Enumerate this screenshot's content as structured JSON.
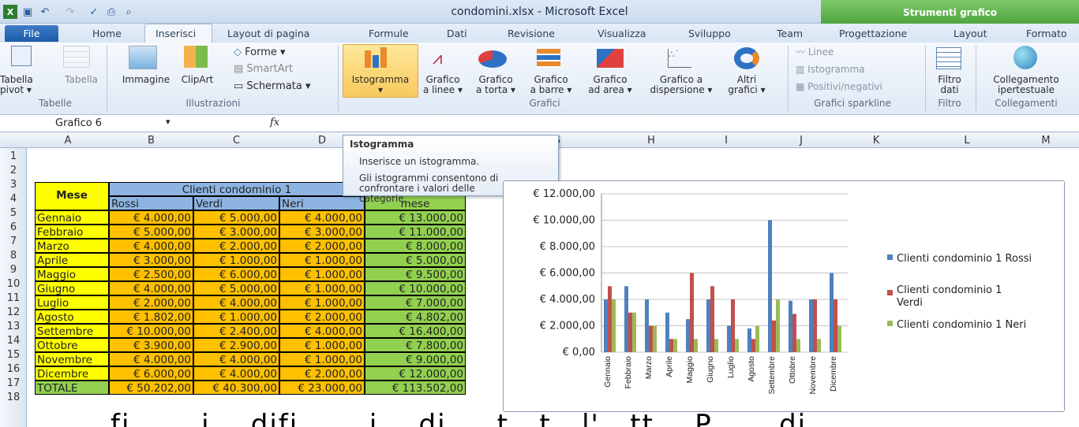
{
  "window": {
    "title": "condomini.xlsx - Microsoft Excel",
    "tools_label": "Strumenti grafico"
  },
  "tabs": [
    "File",
    "Home",
    "Inserisci",
    "Layout di pagina",
    "Formule",
    "Dati",
    "Revisione",
    "Visualizza",
    "Sviluppo",
    "Team",
    "Progettazione",
    "Layout",
    "Formato"
  ],
  "ribbon": {
    "tabelle": {
      "b1a": "Tabella",
      "b1b": "pivot ▾",
      "b2": "Tabella",
      "group": "Tabelle"
    },
    "illustrazioni": {
      "immagine": "Immagine",
      "clipart": "ClipArt",
      "forme": "Forme ▾",
      "smartart": "SmartArt",
      "schermata": "Schermata ▾",
      "group": "Illustrazioni"
    },
    "grafici": {
      "istogramma": "Istogramma",
      "linee_a": "Grafico",
      "linee_b": "a linee ▾",
      "torta_a": "Grafico",
      "torta_b": "a torta ▾",
      "barre_a": "Grafico",
      "barre_b": "a barre ▾",
      "area_a": "Grafico",
      "area_b": "ad area ▾",
      "disp_a": "Grafico a",
      "disp_b": "dispersione ▾",
      "altri_a": "Altri",
      "altri_b": "grafici ▾",
      "group": "Grafici"
    },
    "sparkline": {
      "linee": "Linee",
      "istogramma": "Istogramma",
      "positivi": "Positivi/negativi",
      "group": "Grafici sparkline"
    },
    "filtro": {
      "a": "Filtro",
      "b": "dati",
      "group": "Filtro"
    },
    "collegamenti": {
      "a": "Collegamento",
      "b": "ipertestuale",
      "group": "Collegamenti"
    }
  },
  "formula_bar": {
    "name": "Grafico 6",
    "fx": "fx"
  },
  "tooltip": {
    "title": "Istogramma",
    "line1": "Inserisce un istogramma.",
    "line2a": "Gli istogrammi consentono di",
    "line2b": "confrontare i valori delle",
    "line2c": "categorie."
  },
  "columns": [
    "A",
    "B",
    "C",
    "D",
    "E",
    "F",
    "G",
    "H",
    "I",
    "J",
    "K",
    "L",
    "M"
  ],
  "rows": [
    "1",
    "2",
    "3",
    "4",
    "5",
    "6",
    "7",
    "8",
    "9",
    "10",
    "11",
    "12",
    "13",
    "14",
    "15",
    "16",
    "17",
    "18"
  ],
  "sheet": {
    "mese": "Mese",
    "clienti": "Clienti condominio 1",
    "h_rossi": "Rossi",
    "h_verdi": "Verdi",
    "h_neri": "Neri",
    "h_mese": "mese",
    "data": [
      [
        "Gennaio",
        "€ 4.000,00",
        "€ 5.000,00",
        "€ 4.000,00",
        "€ 13.000,00"
      ],
      [
        "Febbraio",
        "€ 5.000,00",
        "€ 3.000,00",
        "€ 3.000,00",
        "€ 11.000,00"
      ],
      [
        "Marzo",
        "€ 4.000,00",
        "€ 2.000,00",
        "€ 2.000,00",
        "€ 8.000,00"
      ],
      [
        "Aprile",
        "€ 3.000,00",
        "€ 1.000,00",
        "€ 1.000,00",
        "€ 5.000,00"
      ],
      [
        "Maggio",
        "€ 2.500,00",
        "€ 6.000,00",
        "€ 1.000,00",
        "€ 9.500,00"
      ],
      [
        "Giugno",
        "€ 4.000,00",
        "€ 5.000,00",
        "€ 1.000,00",
        "€ 10.000,00"
      ],
      [
        "Luglio",
        "€ 2.000,00",
        "€ 4.000,00",
        "€ 1.000,00",
        "€ 7.000,00"
      ],
      [
        "Agosto",
        "€ 1.802,00",
        "€ 1.000,00",
        "€ 2.000,00",
        "€ 4.802,00"
      ],
      [
        "Settembre",
        "€ 10.000,00",
        "€ 2.400,00",
        "€ 4.000,00",
        "€ 16.400,00"
      ],
      [
        "Ottobre",
        "€ 3.900,00",
        "€ 2.900,00",
        "€ 1.000,00",
        "€ 7.800,00"
      ],
      [
        "Novembre",
        "€ 4.000,00",
        "€ 4.000,00",
        "€ 1.000,00",
        "€ 9.000,00"
      ],
      [
        "Dicembre",
        "€ 6.000,00",
        "€ 4.000,00",
        "€ 2.000,00",
        "€ 12.000,00"
      ],
      [
        "TOTALE",
        "€ 50.202,00",
        "€ 40.300,00",
        "€ 23.000,00",
        "€ 113.502,00"
      ]
    ]
  },
  "colors": {
    "header_blue": "#8db4e2",
    "yellow": "#ffff00",
    "orange": "#ffc000",
    "green": "#92d050",
    "rossi": "#4f81bd",
    "verdi": "#c0504d",
    "neri": "#9bbb59"
  },
  "chart_data": {
    "type": "bar",
    "categories": [
      "Gennaio",
      "Febbraio",
      "Marzo",
      "Aprile",
      "Maggio",
      "Giugno",
      "Luglio",
      "Agosto",
      "Settembre",
      "Ottobre",
      "Novembre",
      "Dicembre"
    ],
    "series": [
      {
        "name": "Clienti condominio 1 Rossi",
        "values": [
          4000,
          5000,
          4000,
          3000,
          2500,
          4000,
          2000,
          1802,
          10000,
          3900,
          4000,
          6000
        ]
      },
      {
        "name": "Clienti condominio 1 Verdi",
        "values": [
          5000,
          3000,
          2000,
          1000,
          6000,
          5000,
          4000,
          1000,
          2400,
          2900,
          4000,
          4000
        ]
      },
      {
        "name": "Clienti condominio 1 Neri",
        "values": [
          4000,
          3000,
          2000,
          1000,
          1000,
          1000,
          1000,
          2000,
          4000,
          1000,
          1000,
          2000
        ]
      }
    ],
    "ylim": [
      0,
      12000
    ],
    "yticks": [
      "€ 0,00",
      "€ 2.000,00",
      "€ 4.000,00",
      "€ 6.000,00",
      "€ 8.000,00",
      "€ 10.000,00",
      "€ 12.000,00"
    ],
    "legend_position": "right"
  },
  "bottom_text": "fi... ...i ...difi... ...i ...di ... t...t...l'...tt... P... ...di"
}
